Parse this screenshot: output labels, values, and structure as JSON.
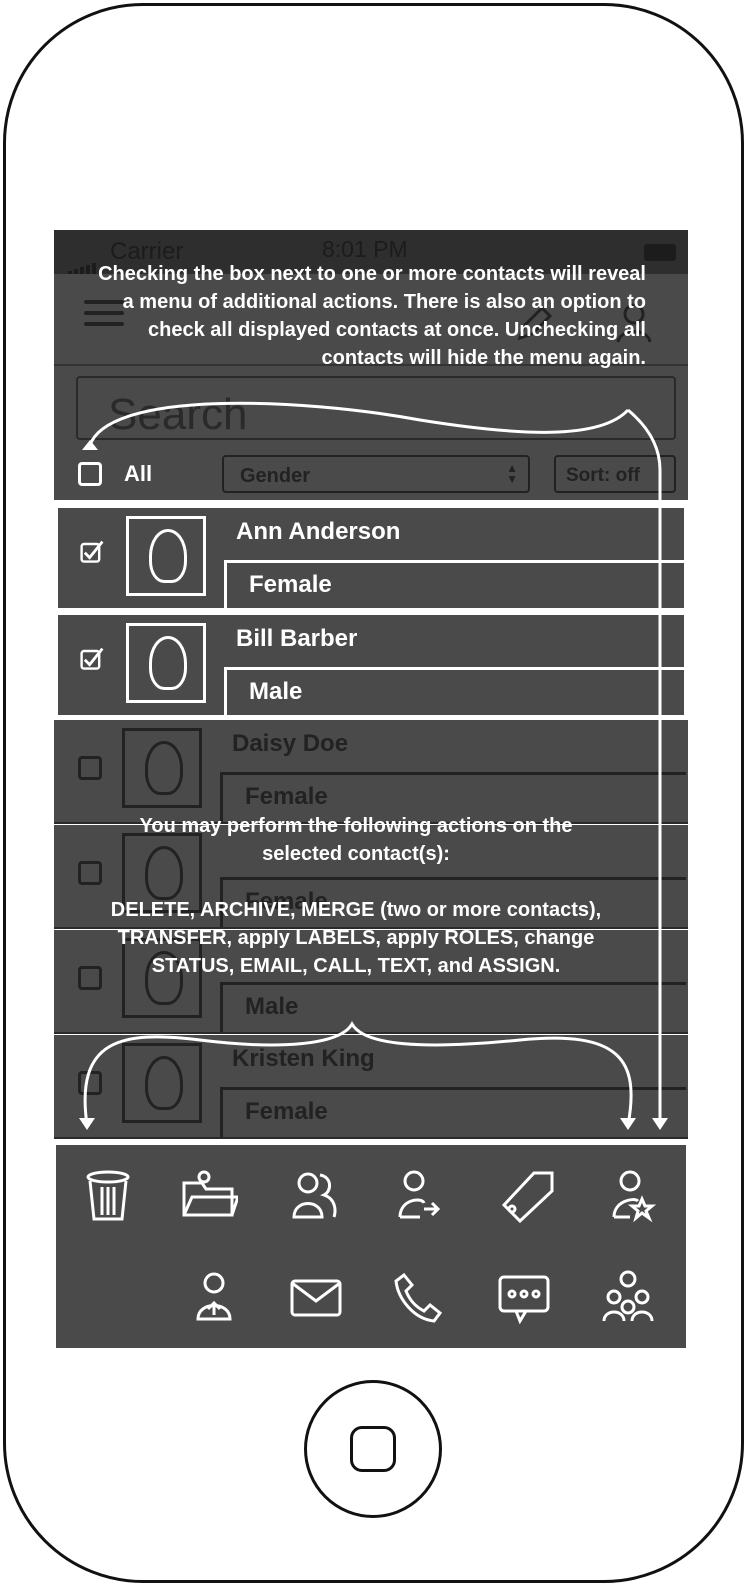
{
  "status_bar": {
    "carrier": "Carrier",
    "time": "8:01 PM"
  },
  "search": {
    "placeholder": "Search"
  },
  "filter_bar": {
    "all_label": "All",
    "gender_select": "Gender",
    "sort_button": "Sort: off"
  },
  "contacts": [
    {
      "name": "Ann Anderson",
      "gender": "Female",
      "checked": true
    },
    {
      "name": "Bill Barber",
      "gender": "Male",
      "checked": true
    },
    {
      "name": "Daisy Doe",
      "gender": "Female",
      "checked": false
    },
    {
      "name": "",
      "gender": "Female",
      "checked": false
    },
    {
      "name": "",
      "gender": "Male",
      "checked": false
    },
    {
      "name": "Kristen King",
      "gender": "Female",
      "checked": false
    }
  ],
  "annotations": {
    "top": "Checking the box next to one or more contacts will reveal a menu of additional actions.  There is also an option to check all displayed contacts at once.  Unchecking all contacts will hide the menu again.",
    "bottom_intro": "You may perform the following actions on the selected contact(s):",
    "bottom_actions": "DELETE,  ARCHIVE,  MERGE (two or more contacts),  TRANSFER, apply LABELS, apply ROLES, change STATUS, EMAIL, CALL, TEXT, and ASSIGN."
  },
  "action_icons": [
    "trash-icon",
    "archive-folder-icon",
    "merge-icon",
    "transfer-icon",
    "label-tag-icon",
    "role-star-icon",
    "status-icon",
    "email-icon",
    "call-phone-icon",
    "text-message-icon",
    "assign-group-icon"
  ]
}
